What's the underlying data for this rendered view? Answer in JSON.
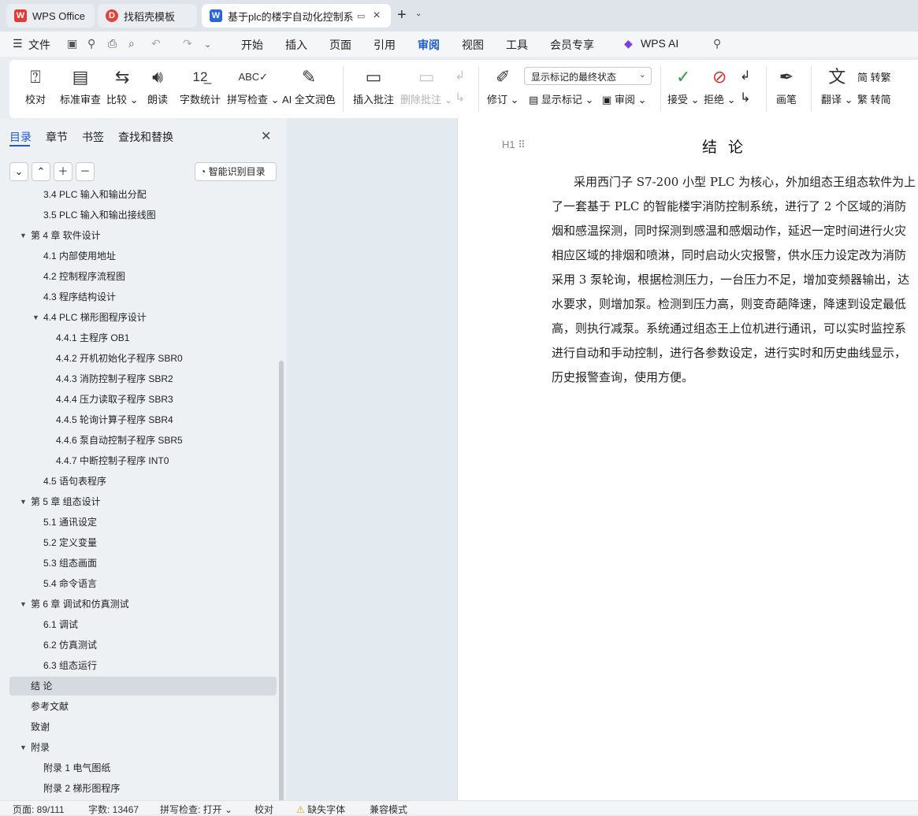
{
  "tabs": [
    {
      "label": "WPS Office",
      "icon": "wps-logo-icon"
    },
    {
      "label": "找稻壳模板",
      "icon": "docer-icon"
    },
    {
      "label": "基于plc的楼宇自动化控制系统",
      "icon": "word-doc-icon"
    }
  ],
  "menu": {
    "file": "文件",
    "items": [
      "开始",
      "插入",
      "页面",
      "引用",
      "审阅",
      "视图",
      "工具",
      "会员专享",
      "WPS AI"
    ],
    "active": "审阅"
  },
  "ribbon": {
    "proofread": "校对",
    "standard_review": "标准审查",
    "compare": "比较",
    "read_aloud": "朗读",
    "word_count": "字数统计",
    "spell_check": "拼写检查",
    "ai_polish": "AI 全文润色",
    "insert_comment": "插入批注",
    "delete_comment": "删除批注",
    "revise": "修订",
    "markup_state": "显示标记的最终状态",
    "show_markup": "显示标记",
    "review": "审阅",
    "accept": "接受",
    "reject": "拒绝",
    "pen": "画笔",
    "translate": "翻译",
    "to_traditional": "转繁",
    "to_simplified": "转简"
  },
  "sidebar": {
    "tabs": [
      "目录",
      "章节",
      "书签",
      "查找和替换"
    ],
    "active_tab": "目录",
    "smart_button": "智能识别目录",
    "toc": [
      {
        "text": "3.4 PLC 输入和输出分配",
        "level": 2
      },
      {
        "text": "3.5   PLC 输入和输出接线图",
        "level": 2
      },
      {
        "text": "第 4 章   软件设计",
        "level": 1,
        "expanded": true
      },
      {
        "text": "4.1   内部使用地址",
        "level": 2
      },
      {
        "text": "4.2   控制程序流程图",
        "level": 2
      },
      {
        "text": "4.3   程序结构设计",
        "level": 2
      },
      {
        "text": "4.4   PLC 梯形图程序设计",
        "level": 2,
        "expanded": true
      },
      {
        "text": "4.4.1  主程序 OB1",
        "level": 3
      },
      {
        "text": "4.4.2  开机初始化子程序 SBR0",
        "level": 3
      },
      {
        "text": "4.4.3 消防控制子程序 SBR2",
        "level": 3
      },
      {
        "text": "4.4.4  压力读取子程序 SBR3",
        "level": 3
      },
      {
        "text": "4.4.5  轮询计算子程序 SBR4",
        "level": 3
      },
      {
        "text": "4.4.6    泵自动控制子程序 SBR5",
        "level": 3
      },
      {
        "text": "4.4.7    中断控制子程序 INT0",
        "level": 3
      },
      {
        "text": "4.5   语句表程序",
        "level": 2
      },
      {
        "text": "第 5 章  组态设计",
        "level": 1,
        "expanded": true
      },
      {
        "text": "5.1   通讯设定",
        "level": 2
      },
      {
        "text": "5.2   定义变量",
        "level": 2
      },
      {
        "text": "5.3   组态画面",
        "level": 2
      },
      {
        "text": "5.4   命令语言",
        "level": 2
      },
      {
        "text": "第 6 章   调试和仿真测试",
        "level": 1,
        "expanded": true
      },
      {
        "text": "6.1   调试",
        "level": 2
      },
      {
        "text": "6.2   仿真测试",
        "level": 2
      },
      {
        "text": "6.3   组态运行",
        "level": 2
      },
      {
        "text": "结   论",
        "level": 1,
        "selected": true
      },
      {
        "text": "参考文献",
        "level": 1
      },
      {
        "text": "致谢",
        "level": 1
      },
      {
        "text": "附录",
        "level": 1,
        "expanded": true
      },
      {
        "text": "附录 1    电气图纸",
        "level": 2
      },
      {
        "text": "附录 2    梯形图程序",
        "level": 2
      }
    ]
  },
  "document": {
    "heading_marker": "H1",
    "title": "结  论",
    "lines": [
      "采用西门子 S7-200 小型 PLC 为核心，外加组态王组态软件为上",
      "了一套基于 PLC 的智能楼宇消防控制系统，进行了 2 个区域的消防",
      "烟和感温探测，同时探测到感温和感烟动作，延迟一定时间进行火灾",
      "相应区域的排烟和喷淋，同时启动火灾报警，供水压力设定改为消防",
      "采用 3 泵轮询，根据检测压力，一台压力不足，增加变频器输出，达",
      "水要求，则增加泵。检测到压力高，则变奇葩降速，降速到设定最低",
      "高，则执行减泵。系统通过组态王上位机进行通讯，可以实时监控系",
      "进行自动和手动控制，进行各参数设定，进行实时和历史曲线显示，",
      "历史报警查询，使用方便。"
    ]
  },
  "statusbar": {
    "page": "页面: 89/111",
    "words": "字数: 13467",
    "spell": "拼写检查: 打开",
    "proof": "校对",
    "missing_font": "缺失字体",
    "compat": "兼容模式"
  }
}
